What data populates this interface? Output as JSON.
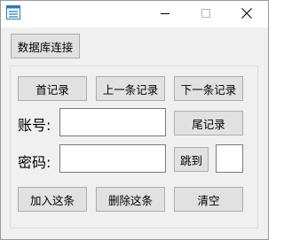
{
  "colors": {
    "window_bg": "#f0f0f0",
    "button_bg": "#e1e1e1",
    "button_border": "#adadad",
    "icon_accent": "#2b7bb9"
  },
  "titlebar": {
    "icon": "app-icon",
    "minimize_icon": "minimize-icon",
    "maximize_icon": "maximize-icon",
    "close_icon": "close-icon"
  },
  "toolbar": {
    "connect_label": "数据库连接"
  },
  "nav": {
    "first_label": "首记录",
    "prev_label": "上一条记录",
    "next_label": "下一条记录",
    "last_label": "尾记录"
  },
  "form": {
    "account_label": "账号:",
    "account_value": "",
    "password_label": "密码:",
    "password_value": "",
    "jump_label": "跳到",
    "jump_value": ""
  },
  "actions": {
    "add_label": "加入这条",
    "delete_label": "删除这条",
    "clear_label": "清空"
  }
}
